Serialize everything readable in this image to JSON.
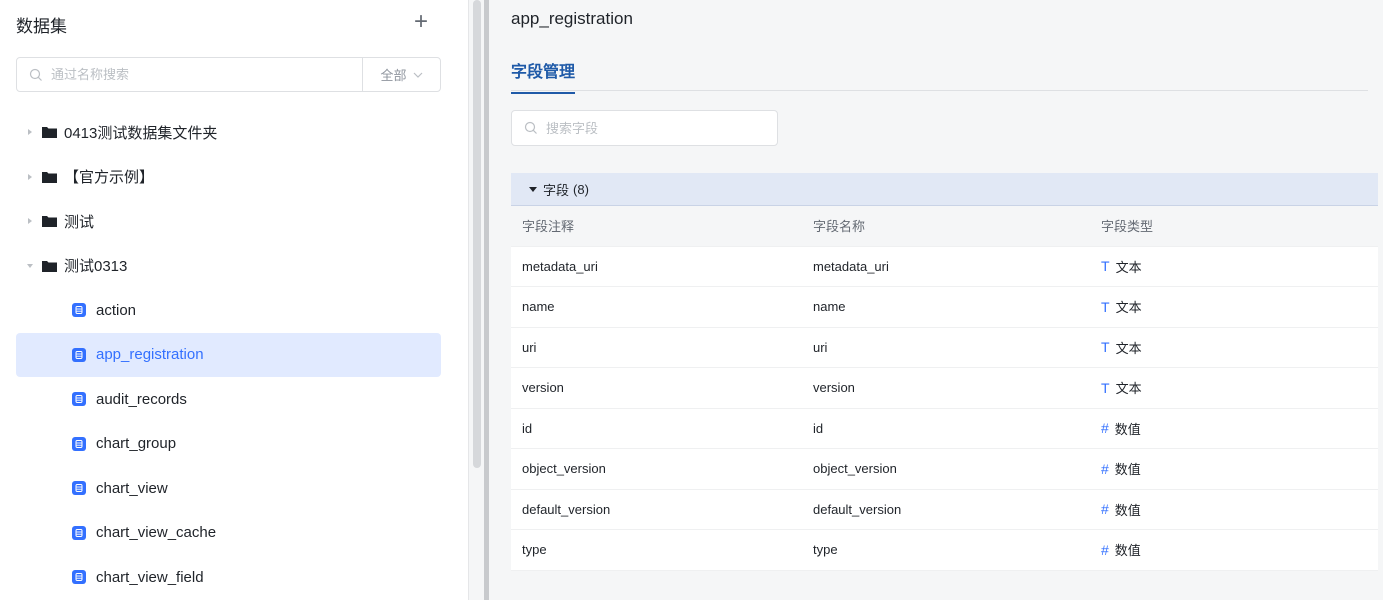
{
  "sidebar": {
    "title": "数据集",
    "add_label": "+",
    "search_placeholder": "通过名称搜索",
    "filter_label": "全部",
    "tree": [
      {
        "type": "folder",
        "label": "0413测试数据集文件夹",
        "expanded": false
      },
      {
        "type": "folder",
        "label": "【官方示例】",
        "expanded": false
      },
      {
        "type": "folder",
        "label": "测试",
        "expanded": false
      },
      {
        "type": "folder",
        "label": "测试0313",
        "expanded": true
      },
      {
        "type": "table",
        "label": "action",
        "active": false
      },
      {
        "type": "table",
        "label": "app_registration",
        "active": true
      },
      {
        "type": "table",
        "label": "audit_records",
        "active": false
      },
      {
        "type": "table",
        "label": "chart_group",
        "active": false
      },
      {
        "type": "table",
        "label": "chart_view",
        "active": false
      },
      {
        "type": "table",
        "label": "chart_view_cache",
        "active": false
      },
      {
        "type": "table",
        "label": "chart_view_field",
        "active": false
      }
    ]
  },
  "main": {
    "title": "app_registration",
    "tab": "字段管理",
    "search_placeholder": "搜索字段",
    "group": {
      "label": "字段",
      "count": "(8)"
    },
    "columns": [
      "字段注释",
      "字段名称",
      "字段类型"
    ],
    "rows": [
      {
        "comment": "metadata_uri",
        "name": "metadata_uri",
        "type_symbol": "T",
        "type": "文本"
      },
      {
        "comment": "name",
        "name": "name",
        "type_symbol": "T",
        "type": "文本"
      },
      {
        "comment": "uri",
        "name": "uri",
        "type_symbol": "T",
        "type": "文本"
      },
      {
        "comment": "version",
        "name": "version",
        "type_symbol": "T",
        "type": "文本"
      },
      {
        "comment": "id",
        "name": "id",
        "type_symbol": "#",
        "type": "数值"
      },
      {
        "comment": "object_version",
        "name": "object_version",
        "type_symbol": "#",
        "type": "数值"
      },
      {
        "comment": "default_version",
        "name": "default_version",
        "type_symbol": "#",
        "type": "数值"
      },
      {
        "comment": "type",
        "name": "type",
        "type_symbol": "#",
        "type": "数值"
      }
    ]
  },
  "colors": {
    "accent": "#3370ff",
    "tab": "#1f5aa8",
    "active_bg": "#e1eaff",
    "group_bg": "#e1e8f5"
  },
  "icons": [
    "search-icon",
    "chevron-down-icon",
    "caret-right-icon",
    "caret-down-icon",
    "folder-icon",
    "database-table-icon",
    "plus-icon"
  ]
}
